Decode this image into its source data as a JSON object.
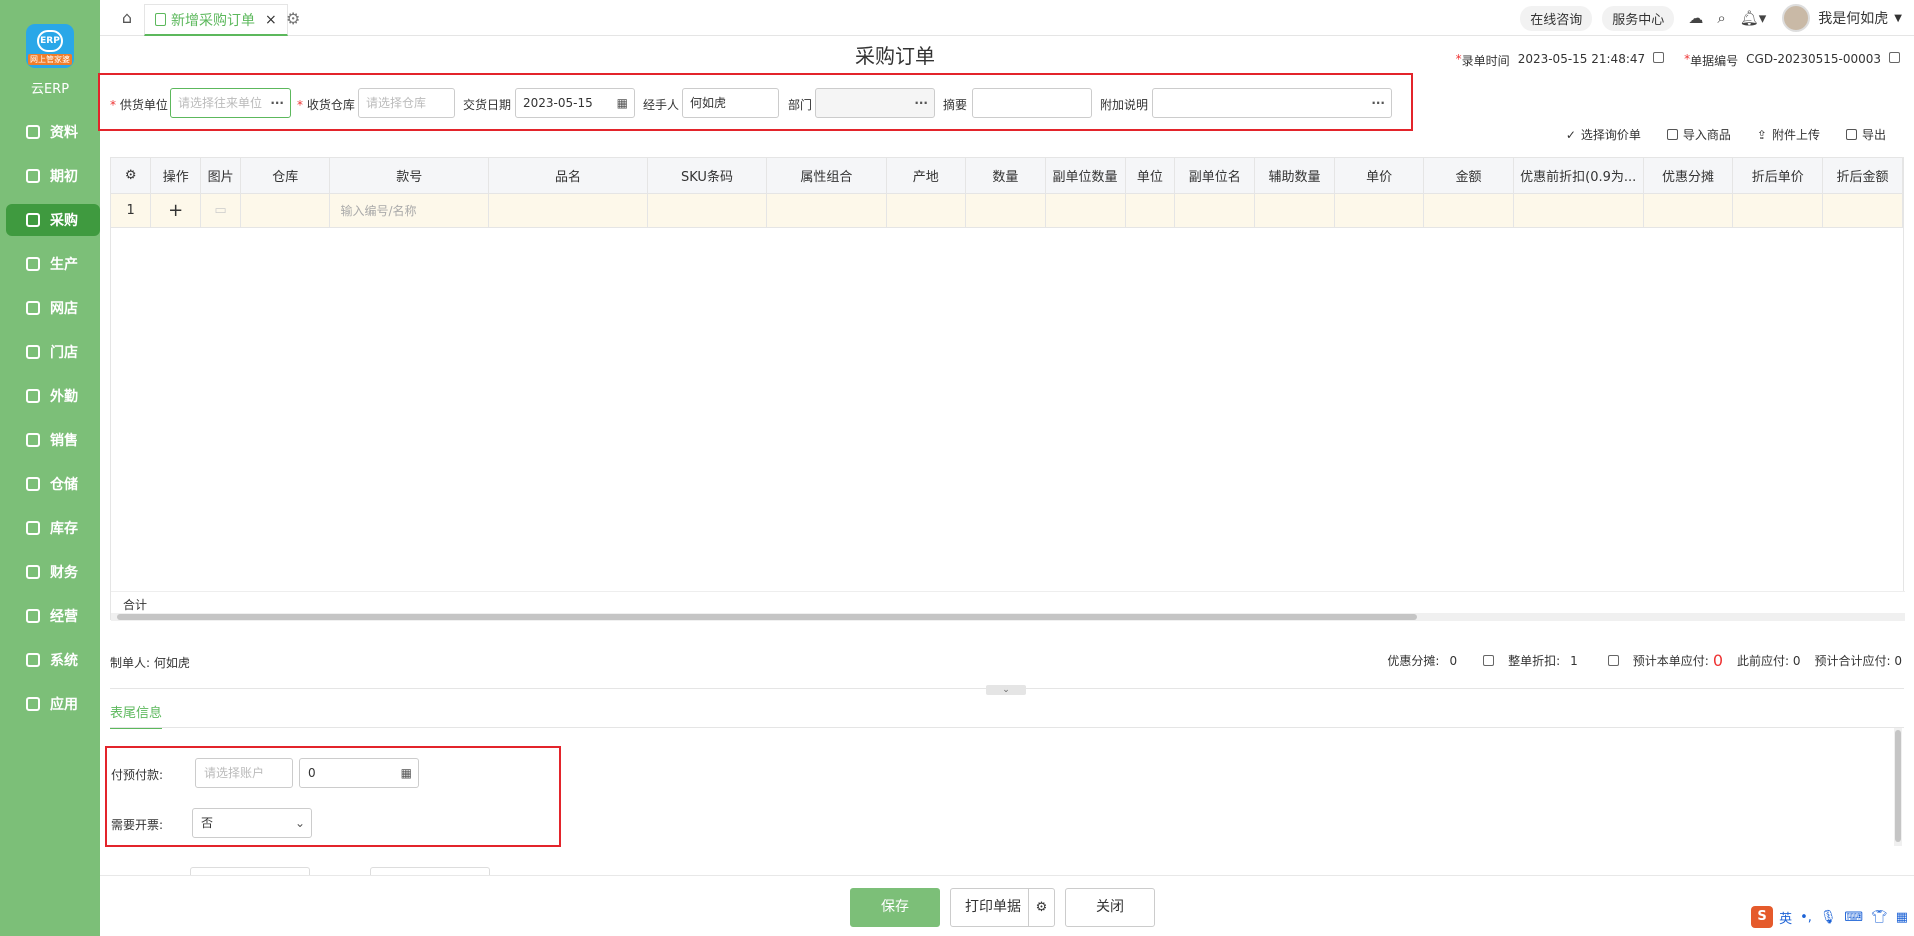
{
  "brand": {
    "logo_text": "ERP",
    "logo_ribbon": "网上管家婆",
    "name": "云ERP"
  },
  "sidebar": {
    "items": [
      {
        "label": "资料",
        "icon": "database-icon"
      },
      {
        "label": "期初",
        "icon": "target-icon"
      },
      {
        "label": "采购",
        "icon": "purchase-icon",
        "active": true
      },
      {
        "label": "生产",
        "icon": "production-icon"
      },
      {
        "label": "网店",
        "icon": "store-icon"
      },
      {
        "label": "门店",
        "icon": "pie-icon"
      },
      {
        "label": "外勤",
        "icon": "field-icon"
      },
      {
        "label": "销售",
        "icon": "sales-chart-icon"
      },
      {
        "label": "仓储",
        "icon": "warehouse-icon"
      },
      {
        "label": "库存",
        "icon": "inventory-icon"
      },
      {
        "label": "财务",
        "icon": "finance-icon"
      },
      {
        "label": "经营",
        "icon": "operation-icon"
      },
      {
        "label": "系统",
        "icon": "system-icon"
      },
      {
        "label": "应用",
        "icon": "apps-icon"
      }
    ]
  },
  "topbar": {
    "tab_label": "新增采购订单",
    "tab_close": "×",
    "online_consult": "在线咨询",
    "service_center": "服务中心",
    "username": "我是何如虎"
  },
  "page": {
    "title": "采购订单",
    "entry_time_label": "录单时间",
    "entry_time": "2023-05-15 21:48:47",
    "doc_no_label": "单据编号",
    "doc_no": "CGD-20230515-00003"
  },
  "form": {
    "supplier_label": "供货单位",
    "supplier_placeholder": "请选择往来单位",
    "warehouse_label": "收货仓库",
    "warehouse_placeholder": "请选择仓库",
    "date_label": "交货日期",
    "date_value": "2023-05-15",
    "handler_label": "经手人",
    "handler_value": "何如虎",
    "dept_label": "部门",
    "summary_label": "摘要",
    "note_label": "附加说明"
  },
  "toolbar": {
    "select_quote": "选择询价单",
    "import_goods": "导入商品",
    "attach_upload": "附件上传",
    "export": "导出"
  },
  "grid": {
    "columns": [
      "操作",
      "图片",
      "仓库",
      "款号",
      "品名",
      "SKU条码",
      "属性组合",
      "产地",
      "数量",
      "副单位数量",
      "单位",
      "副单位名",
      "辅助数量",
      "单价",
      "金额",
      "优惠前折扣(0.9为...",
      "优惠分摊",
      "折后单价",
      "折后金额"
    ],
    "row_no": "1",
    "add_symbol": "+",
    "code_placeholder": "输入编号/名称",
    "sum_label": "合计"
  },
  "summary": {
    "maker_label": "制单人:",
    "maker": "何如虎",
    "discount_share_label": "优惠分摊:",
    "discount_share": "0",
    "whole_discount_label": "整单折扣:",
    "whole_discount": "1",
    "payable_label": "预计本单应付:",
    "payable": "0",
    "prev_payable": "此前应付: 0",
    "total_payable": "预计合计应付: 0"
  },
  "footer": {
    "tab": "表尾信息",
    "prepay_label": "付预付款:",
    "account_placeholder": "请选择账户",
    "prepay_amount": "0",
    "invoice_label": "需要开票:",
    "invoice_value": "否"
  },
  "actions": {
    "save": "保存",
    "print": "打印单据",
    "close": "关闭"
  },
  "ime": {
    "lang": "英"
  },
  "colors": {
    "sidebar": "#7cbf78",
    "accent": "#5cb85c",
    "highlight_box": "#e3242b",
    "row_bg": "#fdf8ea"
  }
}
